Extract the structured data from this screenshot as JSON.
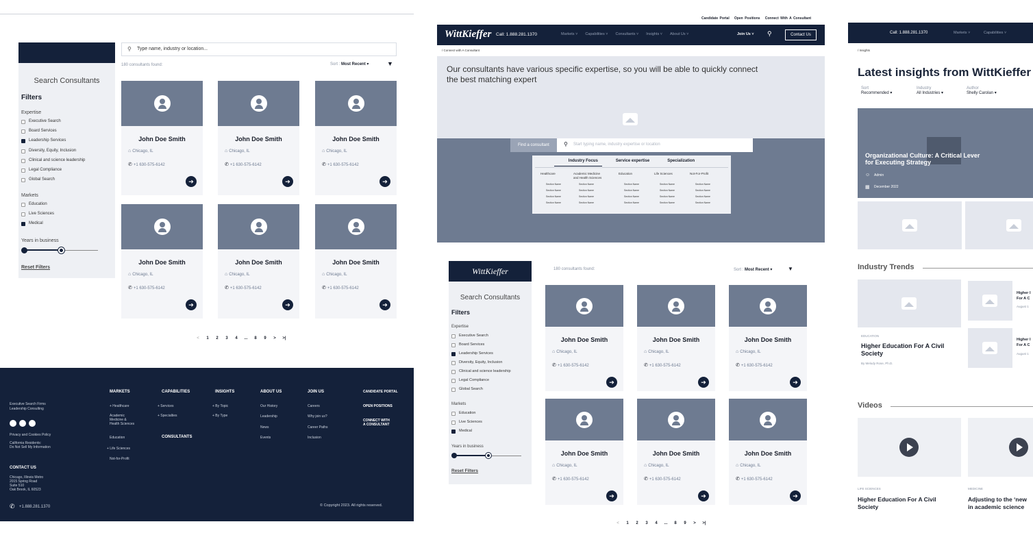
{
  "panel1": {
    "search_placeholder": "Type name, industry or location...",
    "found": "180 consultants found:",
    "sort_label": "Sort :",
    "sort_value": "Most Recent",
    "search_title": "Search Consultants",
    "filters_title": "Filters",
    "expertise_title": "Expertise",
    "expertise": [
      {
        "label": "Executive Search",
        "checked": false
      },
      {
        "label": "Board Services",
        "checked": false
      },
      {
        "label": "Leadership Services",
        "checked": true
      },
      {
        "label": "Diversity, Equity, Inclusion",
        "checked": false
      },
      {
        "label": "Clinical and science leadership",
        "checked": false
      },
      {
        "label": "Legal Compliance",
        "checked": false
      },
      {
        "label": "Global Search",
        "checked": false
      }
    ],
    "markets_title": "Markets",
    "markets": [
      {
        "label": "Education",
        "checked": false
      },
      {
        "label": "Live Sciences",
        "checked": false
      },
      {
        "label": "Medical",
        "checked": true
      }
    ],
    "years_title": "Years in business",
    "reset": "Reset Filters",
    "consultant": {
      "name": "John Doe Smith",
      "location": "Chicago, IL",
      "phone": "+1 630-575-6142"
    },
    "pagination": [
      "<",
      "1",
      "2",
      "3",
      "4",
      "...",
      "8",
      "9",
      ">",
      ">|"
    ]
  },
  "footer": {
    "tagline1": "Executive Search Firms",
    "tagline2": "Leadership Consulting",
    "privacy": "Privacy and Cookies Policy",
    "ca1": "California Residents:",
    "ca2": "Do Not Sell My Information",
    "contact_title": "CONTACT US",
    "addr1": "Chicago, Illinois Metro",
    "addr2": "2015 Spring Road",
    "addr3": "Suite 510",
    "addr4": "Oak Brook, IL 60523",
    "phone": "+1.888.281.1370",
    "markets": "MARKETS",
    "m1": "+ Healthcare",
    "m2": "Academic",
    "m2b": "Medicine &",
    "m2c": "Health Sciences",
    "m3": "Education",
    "m4": "+ Life Sciences",
    "m5": "Not-for-Profit",
    "capabilities": "CAPABILITIES",
    "c1": "+ Services",
    "c2": "+ Specialties",
    "consultants": "CONSULTANTS",
    "insights": "INSIGHTS",
    "i1": "+ By Topic",
    "i2": "+ By Type",
    "about": "ABOUT US",
    "a1": "Our History",
    "a2": "Leadership",
    "a3": "News",
    "a4": "Events",
    "join": "JOIN US",
    "j1": "Careers",
    "j2": "Why join us?",
    "j3": "Career Paths",
    "j4": "Inclusion",
    "portal": "CANDIDATE PORTAL",
    "positions": "OPEN POSITIONS",
    "connect1": "CONNECT WITH",
    "connect2": "A CONSULTANT",
    "copyright": "© Copyright 2023. All rights reserved."
  },
  "panel2": {
    "util1": "Candidate Portal",
    "util2": "Open Positions",
    "util3": "Connect With A Consultant",
    "logo": "WittKieffer",
    "call": "Call: 1.888.281.1370",
    "nav": [
      "Markets ˅",
      "Capabilities ˅",
      "Consultants ˅",
      "Insights ˅",
      "About Us ˅"
    ],
    "join": "Join Us ˅",
    "contact": "Contact Us",
    "crumb": "/ Connect with A Consultant",
    "hero1": "Our consultants have various specific expertise, so you will be able to quickly connect",
    "hero2": "the best matching expert",
    "find": "Find a consultant",
    "find_placeholder": "Start typing name, industry expertise or location",
    "tabs": [
      "Industry Focus",
      "Service expertise",
      "Specialization"
    ],
    "cols": [
      "Healthcare",
      "Academic Medicine",
      "Education",
      "Life Sciences",
      "Not-For-Profit"
    ],
    "col2b": "and Health Sciences",
    "section": "Section Name",
    "found": "180 consultants found:",
    "sort_label": "Sort :",
    "sort_value": "Most Recent",
    "search_title": "Search Consultants",
    "filters_title": "Filters"
  },
  "panel3": {
    "call": "Call: 1.888.281.1370",
    "nav1": "Markets ˅",
    "nav2": "Capabilities ˅",
    "crumb": "/ Insights",
    "title": "Latest insights from WittKieffer",
    "sort_l": "Sort",
    "sort_v": "Recommended",
    "ind_l": "Industry",
    "ind_v": "All Industries",
    "auth_l": "Author",
    "auth_v": "Shelly Carolan",
    "feat1": "Organizational Culture: A Critical Lever",
    "feat2": "for Executing Strategy",
    "admin": "Admin",
    "date": "December 2022",
    "trends": "Industry Trends",
    "edu": "EDUCATION",
    "he1": "Higher Education For A Civil",
    "he2": "Society",
    "by": "By Melody Rose, Ph.D.",
    "s1a": "Higher I",
    "s1b": "For A C",
    "s1c": "August 1",
    "s2a": "Higher I",
    "s2b": "For A C",
    "s2c": "August 1",
    "videos": "Videos",
    "ls": "LIFE SCIENCES",
    "v1a": "Higher Education For A Civil",
    "v1b": "Society",
    "med": "MEDICINE",
    "v2a": "Adjusting to the ‘new",
    "v2b": "in academic science"
  }
}
